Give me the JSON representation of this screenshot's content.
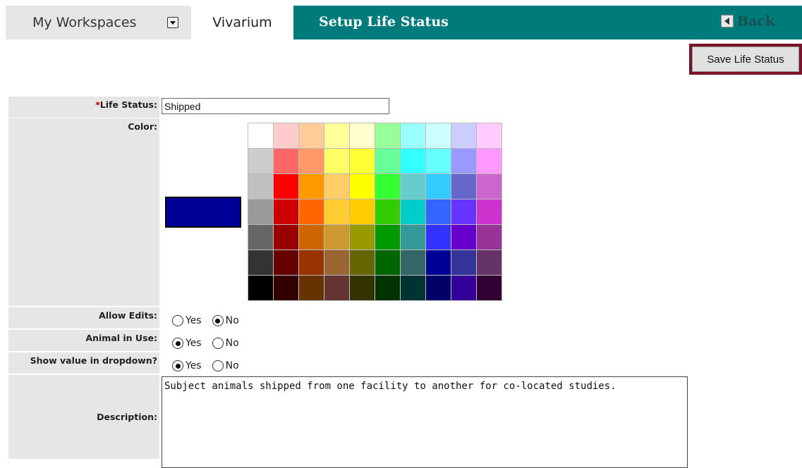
{
  "header": {
    "workspaces_label": "My Workspaces",
    "module_tab": "Vivarium",
    "page_title": "Setup Life Status",
    "back_label": "Back"
  },
  "toolbar": {
    "save_label": "Save Life Status"
  },
  "form": {
    "life_status_label": "Life Status:",
    "required_mark": "*",
    "life_status_value": "Shipped",
    "color_label": "Color:",
    "selected_color": "#000099",
    "palette": [
      [
        "#ffffff",
        "#ffcccc",
        "#ffcc99",
        "#ffff99",
        "#ffffcc",
        "#99ff99",
        "#99ffff",
        "#ccffff",
        "#ccccff",
        "#ffccff"
      ],
      [
        "#cccccc",
        "#ff6666",
        "#ff9966",
        "#ffff66",
        "#ffff33",
        "#66ff99",
        "#33ffff",
        "#66ffff",
        "#9999ff",
        "#ff99ff"
      ],
      [
        "#c0c0c0",
        "#ff0000",
        "#ff9900",
        "#ffcc66",
        "#ffff00",
        "#33ff33",
        "#66cccc",
        "#33ccff",
        "#6666cc",
        "#cc66cc"
      ],
      [
        "#999999",
        "#cc0000",
        "#ff6600",
        "#ffcc33",
        "#ffcc00",
        "#33cc00",
        "#00cccc",
        "#3366ff",
        "#6633ff",
        "#cc33cc"
      ],
      [
        "#666666",
        "#990000",
        "#cc6600",
        "#cc9933",
        "#999900",
        "#009900",
        "#339999",
        "#3333ff",
        "#6600cc",
        "#993399"
      ],
      [
        "#333333",
        "#660000",
        "#993300",
        "#996633",
        "#666600",
        "#006600",
        "#336666",
        "#000099",
        "#333399",
        "#663366"
      ],
      [
        "#000000",
        "#330000",
        "#663300",
        "#663333",
        "#333300",
        "#003300",
        "#003333",
        "#000066",
        "#330099",
        "#330033"
      ]
    ],
    "allow_edits": {
      "label": "Allow Edits:",
      "yes": "Yes",
      "no": "No",
      "value": "no"
    },
    "animal_in_use": {
      "label": "Animal in Use:",
      "yes": "Yes",
      "no": "No",
      "value": "yes"
    },
    "show_in_dropdown": {
      "label": "Show value in dropdown?",
      "yes": "Yes",
      "no": "No",
      "value": "yes"
    },
    "description_label": "Description:",
    "description_value": "Subject animals shipped from one facility to another for co-located studies."
  }
}
